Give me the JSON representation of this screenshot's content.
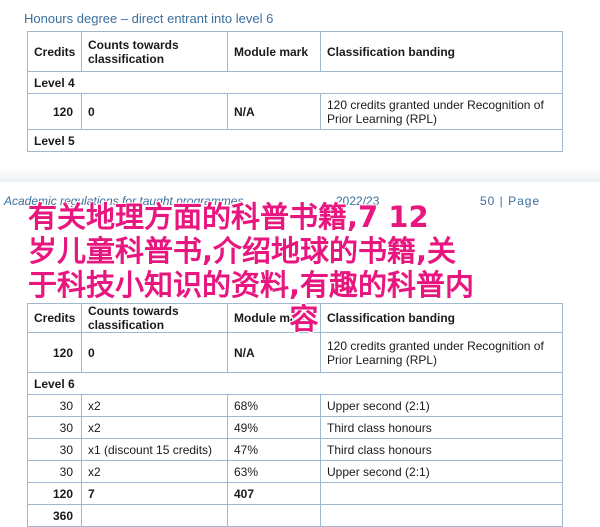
{
  "heading": "Honours degree – direct entrant into level 6",
  "columns": {
    "credits": "Credits",
    "counts": "Counts towards classification",
    "module_mark": "Module mark",
    "banding": "Classification banding"
  },
  "table1": {
    "level4_label": "Level 4",
    "row": {
      "credits": "120",
      "counts": "0",
      "mark": "N/A",
      "banding": "120 credits granted under Recognition of Prior Learning (RPL)"
    },
    "level5_label": "Level 5"
  },
  "footer": {
    "left": "Academic regulations for taught programmes",
    "mid": "2022/23",
    "right": "50 | Page"
  },
  "overlay_title": {
    "line1": "有关地理方面的科普书籍,7 12",
    "line2": "岁儿童科普书,介绍地球的书籍,关",
    "line3": "于科技小知识的资料,有趣的科普内",
    "line4": "容"
  },
  "table2": {
    "rows_top": [
      {
        "credits": "120",
        "counts": "0",
        "mark": "N/A",
        "banding": "120 credits granted under Recognition of Prior Learning (RPL)"
      }
    ],
    "level6_label": "Level 6",
    "rows": [
      {
        "credits": "30",
        "counts": "x2",
        "mark": "68%",
        "banding": "Upper second (2:1)"
      },
      {
        "credits": "30",
        "counts": "x2",
        "mark": "49%",
        "banding": "Third class honours"
      },
      {
        "credits": "30",
        "counts": "x1 (discount 15 credits)",
        "mark": "47%",
        "banding": "Third class honours"
      },
      {
        "credits": "30",
        "counts": "x2",
        "mark": "63%",
        "banding": "Upper second (2:1)"
      }
    ],
    "total": {
      "credits": "120",
      "counts": "7",
      "mark": "407"
    },
    "grand_total": {
      "credits": "360"
    }
  }
}
